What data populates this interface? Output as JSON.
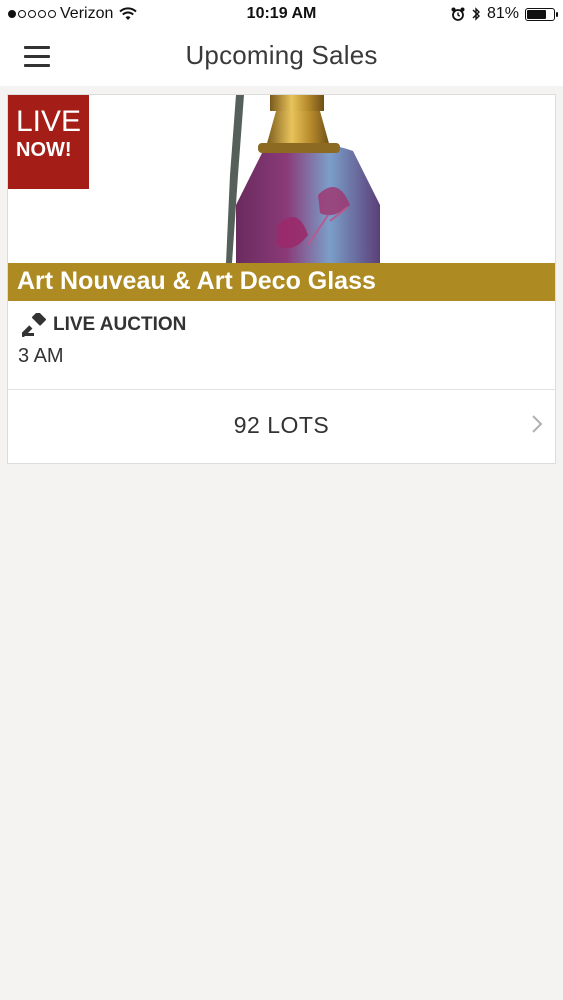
{
  "status_bar": {
    "carrier": "Verizon",
    "time": "10:19 AM",
    "battery": "81%",
    "battery_level": 0.81,
    "signal_bars_filled": 1,
    "signal_bars_total": 5
  },
  "nav": {
    "title": "Upcoming Sales",
    "menu_icon": "hamburger-menu-icon"
  },
  "sale": {
    "badge_line1": "LIVE",
    "badge_line2": "NOW!",
    "title": "Art Nouveau & Art Deco Glass",
    "type": "LIVE AUCTION",
    "type_icon": "gavel-icon",
    "time": "3 AM",
    "lots": "92 LOTS",
    "lots_icon": "chevron-right-icon"
  },
  "colors": {
    "badge_bg": "#a41d16",
    "title_band_bg": "#ad8a22",
    "page_bg": "#f4f3f1"
  }
}
